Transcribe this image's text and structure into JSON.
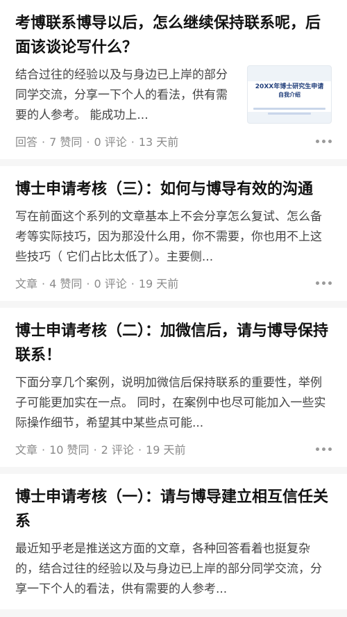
{
  "feed": {
    "items": [
      {
        "title": "考博联系博导以后，怎么继续保持联系呢，后面该谈论写什么？",
        "excerpt": "结合过往的经验以及与身边已上岸的部分同学交流，分享一下个人的看法，供有需要的人参考。 能成功上...",
        "type": "回答",
        "likes": "7 赞同",
        "comments": "0 评论",
        "time": "13 天前",
        "thumbnail": {
          "title": "20XX年博士研究生申请",
          "subtitle": "自我介绍"
        }
      },
      {
        "title": "博士申请考核（三）：如何与博导有效的沟通",
        "excerpt": "写在前面这个系列的文章基本上不会分享怎么复试、怎么备考等实际技巧，因为那没什么用，你不需要，你也用不上这些技巧（ 它们占比太低了）。主要侧...",
        "type": "文章",
        "likes": "4 赞同",
        "comments": "0 评论",
        "time": "19 天前"
      },
      {
        "title": "博士申请考核（二）：加微信后，请与博导保持联系！",
        "excerpt": "下面分享几个案例，说明加微信后保持联系的重要性，举例子可能更加实在一点。 同时，在案例中也尽可能加入一些实际操作细节，希望其中某些点可能...",
        "type": "文章",
        "likes": "10 赞同",
        "comments": "2 评论",
        "time": "19 天前"
      },
      {
        "title": "博士申请考核（一）：请与博导建立相互信任关系",
        "excerpt": "最近知乎老是推送这方面的文章，各种回答看着也挺复杂的，结合过往的经验以及与身边已上岸的部分同学交流，分享一下个人的看法，供有需要的人参考..."
      }
    ],
    "separator": "·"
  }
}
